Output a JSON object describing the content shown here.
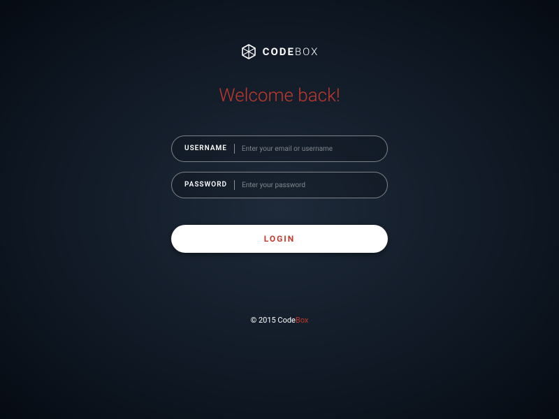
{
  "logo": {
    "brand_bold": "CODE",
    "brand_light": "BOX"
  },
  "welcome": "Welcome back!",
  "form": {
    "username": {
      "label": "USERNAME",
      "placeholder": "Enter your email or username"
    },
    "password": {
      "label": "PASSWORD",
      "placeholder": "Enter your password"
    },
    "login_label": "LOGIN"
  },
  "footer": {
    "copyright_prefix": "© 2015 ",
    "brand_left": "Code",
    "brand_right": "Box"
  }
}
